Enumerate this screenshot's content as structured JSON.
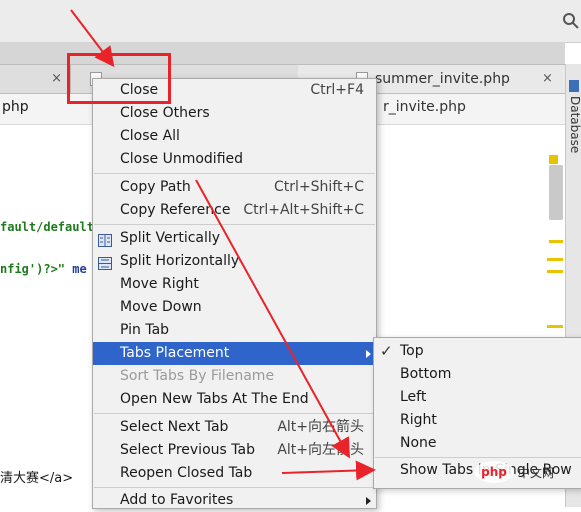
{
  "tabs": {
    "left_tab_partial": "",
    "left_tab_close": "×",
    "right_tab_label": "summer_invite.php",
    "right_tab_close": "×"
  },
  "breadcrumbs": {
    "left_partial": "php",
    "right_partial": "r_invite.php"
  },
  "sidebar": {
    "label": "Database"
  },
  "code": {
    "line1": "fault/default",
    "line2_part1": "nfig')?>\"",
    "line2_part2": "me"
  },
  "bottom_text": {
    "left": "清大赛</a>"
  },
  "context_menu": {
    "items": [
      {
        "label": "Close",
        "shortcut": "Ctrl+F4"
      },
      {
        "label": "Close Others",
        "shortcut": ""
      },
      {
        "label": "Close All",
        "shortcut": ""
      },
      {
        "label": "Close Unmodified",
        "shortcut": ""
      },
      {
        "label": "Copy Path",
        "shortcut": "Ctrl+Shift+C"
      },
      {
        "label": "Copy Reference",
        "shortcut": "Ctrl+Alt+Shift+C"
      },
      {
        "label": "Split Vertically",
        "shortcut": ""
      },
      {
        "label": "Split Horizontally",
        "shortcut": ""
      },
      {
        "label": "Move Right",
        "shortcut": ""
      },
      {
        "label": "Move Down",
        "shortcut": ""
      },
      {
        "label": "Pin Tab",
        "shortcut": ""
      },
      {
        "label": "Tabs Placement",
        "shortcut": ""
      },
      {
        "label": "Sort Tabs By Filename",
        "shortcut": ""
      },
      {
        "label": "Open New Tabs At The End",
        "shortcut": ""
      },
      {
        "label": "Select Next Tab",
        "shortcut": "Alt+向右箭头"
      },
      {
        "label": "Select Previous Tab",
        "shortcut": "Alt+向左箭头"
      },
      {
        "label": "Reopen Closed Tab",
        "shortcut": ""
      },
      {
        "label": "Add to Favorites",
        "shortcut": ""
      }
    ]
  },
  "tabs_placement_submenu": {
    "items": [
      {
        "label": "Top",
        "checked": true
      },
      {
        "label": "Bottom",
        "checked": false
      },
      {
        "label": "Left",
        "checked": false
      },
      {
        "label": "Right",
        "checked": false
      },
      {
        "label": "None",
        "checked": false
      },
      {
        "label": "Show Tabs In Single Row",
        "checked": false
      }
    ],
    "check_glyph": "✓"
  },
  "watermark": {
    "text": "php 中文网"
  },
  "colors": {
    "highlight": "#2f65ca",
    "annotation_red": "#e8232a",
    "marker_yellow": "#e8c400"
  }
}
